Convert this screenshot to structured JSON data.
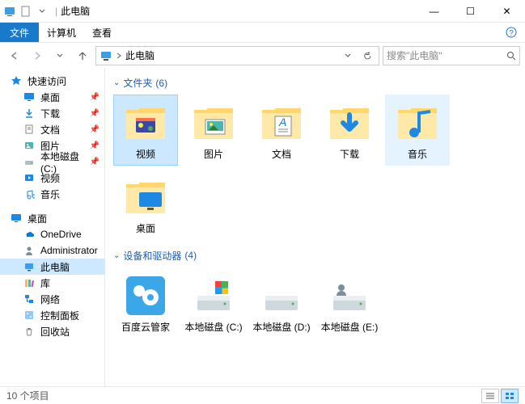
{
  "titlebar": {
    "title": "此电脑"
  },
  "winctrls": {
    "min": "—",
    "max": "☐",
    "close": "✕"
  },
  "menubar": {
    "file": "文件",
    "computer": "计算机",
    "view": "查看"
  },
  "addrbar": {
    "crumb": "此电脑",
    "search_placeholder": "搜索\"此电脑\""
  },
  "sidebar": {
    "quick": {
      "label": "快速访问",
      "items": [
        {
          "label": "桌面",
          "pinned": true,
          "icon": "desktop"
        },
        {
          "label": "下载",
          "pinned": true,
          "icon": "downloads"
        },
        {
          "label": "文档",
          "pinned": true,
          "icon": "documents"
        },
        {
          "label": "图片",
          "pinned": true,
          "icon": "pictures"
        },
        {
          "label": "本地磁盘 (C:)",
          "pinned": true,
          "icon": "drive"
        },
        {
          "label": "视频",
          "pinned": false,
          "icon": "videos"
        },
        {
          "label": "音乐",
          "pinned": false,
          "icon": "music"
        }
      ]
    },
    "desktop": {
      "label": "桌面",
      "items": [
        {
          "label": "OneDrive",
          "icon": "onedrive"
        },
        {
          "label": "Administrator",
          "icon": "user"
        },
        {
          "label": "此电脑",
          "icon": "thispc",
          "selected": true
        },
        {
          "label": "库",
          "icon": "libraries"
        },
        {
          "label": "网络",
          "icon": "network"
        },
        {
          "label": "控制面板",
          "icon": "control"
        },
        {
          "label": "回收站",
          "icon": "recycle"
        }
      ]
    }
  },
  "content": {
    "group1": {
      "label": "文件夹",
      "count": "(6)",
      "items": [
        {
          "label": "视频",
          "icon": "folder-videos",
          "selected": true
        },
        {
          "label": "图片",
          "icon": "folder-pictures"
        },
        {
          "label": "文档",
          "icon": "folder-documents"
        },
        {
          "label": "下载",
          "icon": "folder-downloads"
        },
        {
          "label": "音乐",
          "icon": "folder-music",
          "hover": true
        },
        {
          "label": "桌面",
          "icon": "folder-desktop"
        }
      ]
    },
    "group2": {
      "label": "设备和驱动器",
      "count": "(4)",
      "items": [
        {
          "label": "百度云管家",
          "icon": "baiduyun"
        },
        {
          "label": "本地磁盘 (C:)",
          "icon": "drive-c"
        },
        {
          "label": "本地磁盘 (D:)",
          "icon": "drive"
        },
        {
          "label": "本地磁盘 (E:)",
          "icon": "drive-user"
        }
      ]
    }
  },
  "statusbar": {
    "text": "10 个项目"
  }
}
